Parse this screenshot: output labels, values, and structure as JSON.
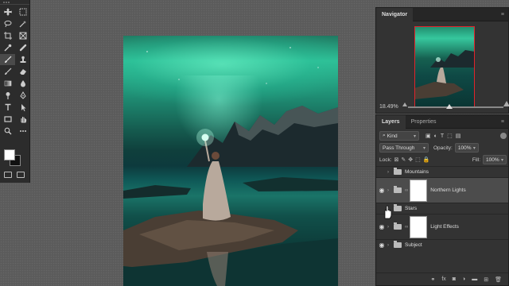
{
  "navigator": {
    "tab_label": "Navigator",
    "zoom_label": "18.49%"
  },
  "layers": {
    "tabs": [
      "Layers",
      "Properties"
    ],
    "filter_label": "Kind",
    "blend_mode": "Pass Through",
    "opacity_label": "Opacity:",
    "opacity_value": "100%",
    "lock_label": "Lock:",
    "fill_label": "Fill:",
    "fill_value": "100%",
    "items": [
      {
        "name": "Mountains",
        "type": "group",
        "visible": false
      },
      {
        "name": "Northern Lights",
        "type": "group-with-mask",
        "visible": true
      },
      {
        "name": "Stars",
        "type": "group",
        "visible": false
      },
      {
        "name": "Light Effects",
        "type": "group-with-mask",
        "visible": true
      },
      {
        "name": "Subject",
        "type": "group",
        "visible": true
      }
    ]
  },
  "toolbar": {
    "tools": [
      "move-tool",
      "artboard-tool",
      "lasso-tool",
      "magic-wand-tool",
      "crop-tool",
      "frame-tool",
      "eyedropper-tool",
      "healing-brush-tool",
      "brush-tool",
      "clone-stamp-tool",
      "history-brush-tool",
      "eraser-tool",
      "gradient-tool",
      "blur-tool",
      "dodge-tool",
      "pen-tool",
      "type-tool",
      "path-selection-tool",
      "rectangle-tool",
      "hand-tool",
      "zoom-tool",
      "more-tools"
    ],
    "active_tool": "brush-tool",
    "foreground_color": "#ffffff",
    "background_color": "#111111"
  },
  "colors": {
    "panel_bg": "#333333",
    "canvas_area": "#5b5b5b",
    "aurora": "#36c79d",
    "navigator_view_box": "#e0242b"
  }
}
